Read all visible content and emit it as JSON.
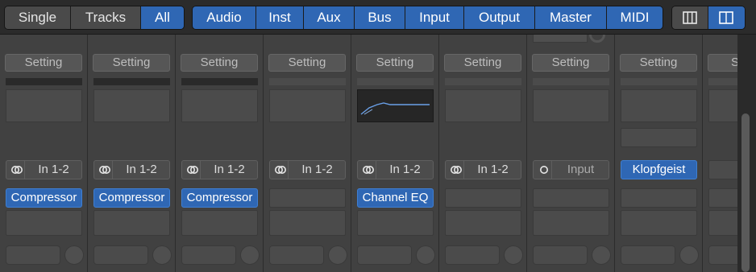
{
  "view_mode": {
    "items": [
      {
        "label": "Single",
        "active": false
      },
      {
        "label": "Tracks",
        "active": false
      },
      {
        "label": "All",
        "active": true
      }
    ]
  },
  "filters": {
    "items": [
      {
        "label": "Audio"
      },
      {
        "label": "Inst"
      },
      {
        "label": "Aux"
      },
      {
        "label": "Bus"
      },
      {
        "label": "Input"
      },
      {
        "label": "Output"
      },
      {
        "label": "Master"
      },
      {
        "label": "MIDI"
      }
    ]
  },
  "layout_buttons": [
    {
      "icon": "narrow-columns-icon",
      "active": false
    },
    {
      "icon": "wide-columns-icon",
      "active": true
    }
  ],
  "strips": [
    {
      "setting": "Setting",
      "input": "In 1-2",
      "input_icon": "stereo-link-icon",
      "plugin": "Compressor"
    },
    {
      "setting": "Setting",
      "input": "In 1-2",
      "input_icon": "stereo-link-icon",
      "plugin": "Compressor"
    },
    {
      "setting": "Setting",
      "input": "In 1-2",
      "input_icon": "stereo-link-icon",
      "plugin": "Compressor"
    },
    {
      "setting": "Setting",
      "input": "In 1-2",
      "input_icon": "stereo-link-icon",
      "plugin": ""
    },
    {
      "setting": "Setting",
      "input": "In 1-2",
      "input_icon": "stereo-link-icon",
      "plugin": "Channel EQ"
    },
    {
      "setting": "Setting",
      "input": "In 1-2",
      "input_icon": "stereo-link-icon",
      "plugin": ""
    },
    {
      "setting": "Setting",
      "input": "Input",
      "input_icon": "mono-icon",
      "plugin": ""
    },
    {
      "setting": "Setting",
      "name": "Klopfgeist",
      "plugin": ""
    },
    {
      "setting": "Se"
    }
  ],
  "colors": {
    "accent": "#2f67b4",
    "background": "#333333"
  }
}
